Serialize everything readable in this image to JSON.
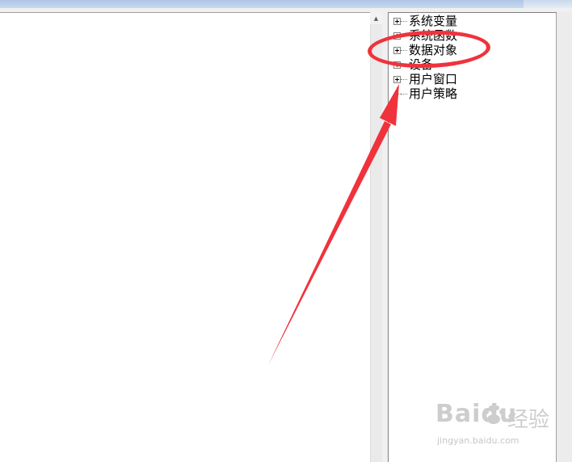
{
  "tree": {
    "items": [
      {
        "label": "系统变量",
        "expandable": true
      },
      {
        "label": "系统函数",
        "expandable": true
      },
      {
        "label": "数据对象",
        "expandable": true
      },
      {
        "label": "设备",
        "expandable": true
      },
      {
        "label": "用户窗口",
        "expandable": true
      },
      {
        "label": "用户策略",
        "expandable": false
      }
    ]
  },
  "annotation": {
    "highlight_color": "#f0323c"
  },
  "watermark": {
    "logo": "Baidu",
    "suffix": "经验",
    "url": "jingyan.baidu.com"
  },
  "icons": {
    "scroll_up": "scroll-up-arrow-icon",
    "expander": "plus-box-icon",
    "paw": "baidu-paw-icon"
  }
}
